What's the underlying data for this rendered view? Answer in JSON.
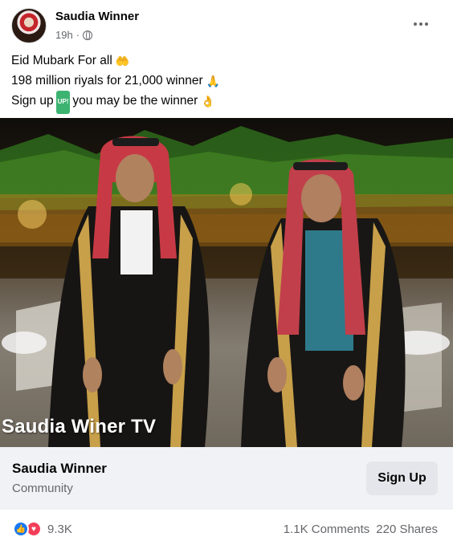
{
  "post": {
    "author": "Saudia Winner",
    "time": "19h",
    "privacy_icon": "globe-icon",
    "menu_icon": "more-options-icon",
    "lines": [
      {
        "text": "Eid Mubark For all",
        "emoji": "raising-hands-emoji"
      },
      {
        "text": "198 million riyals for 21,000 winner",
        "emoji": "folded-hands-emoji"
      },
      {
        "before": "Sign up",
        "badge": "UP!",
        "after": "you may be the winner",
        "emoji": "ok-hand-emoji"
      }
    ],
    "image_watermark": "Saudia Winer TV"
  },
  "cta": {
    "title": "Saudia Winner",
    "subtitle": "Community",
    "button_label": "Sign Up"
  },
  "stats": {
    "reaction_icons": [
      "like-icon",
      "love-icon"
    ],
    "reaction_count": "9.3K",
    "comments": "1.1K Comments",
    "shares": "220 Shares"
  },
  "colors": {
    "like": "#1877f2",
    "love": "#f33e58",
    "secondary_text": "#65676b",
    "cta_background": "#f0f2f5"
  }
}
